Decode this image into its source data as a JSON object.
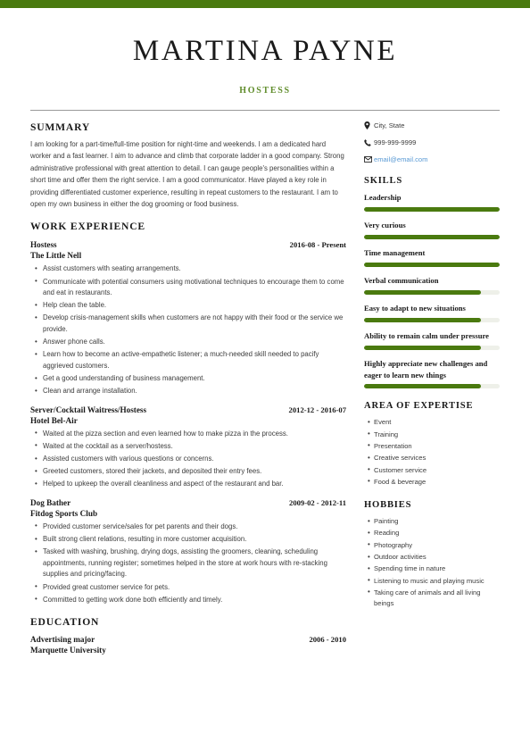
{
  "theme": {
    "accent_green": "#4a7a0f",
    "title_green": "#5f8c2a",
    "link_blue": "#5b9bd5",
    "track_gray": "#eef0e9"
  },
  "header": {
    "name": "MARTINA PAYNE",
    "job_title": "HOSTESS"
  },
  "summary": {
    "heading": "SUMMARY",
    "text": "I am looking for a part-time/full-time position for night-time and weekends. I am a dedicated hard worker and a fast learner. I aim to advance and climb that corporate ladder in a good company. Strong administrative professional with great attention to detail. I can gauge people's personalities within a short time and offer them the right service. I am a good communicator. Have played a key role in providing differentiated customer experience, resulting in repeat customers to the restaurant. I am to open my own business in either the dog grooming or food business."
  },
  "work_experience": {
    "heading": "WORK EXPERIENCE",
    "jobs": [
      {
        "position": "Hostess",
        "date": "2016-08 - Present",
        "company": "The Little Nell",
        "bullets": [
          "Assist customers with seating arrangements.",
          "Communicate with potential consumers using motivational techniques to encourage them to come and eat in restaurants.",
          "Help clean the table.",
          "Develop crisis-management skills when customers are not happy with their food or the service we provide.",
          "Answer phone calls.",
          "Learn how to become an active-empathetic listener; a much-needed skill needed to pacify aggrieved customers.",
          "Get a good understanding of business management.",
          "Clean and arrange installation."
        ]
      },
      {
        "position": "Server/Cocktail Waitress/Hostess",
        "date": "2012-12 - 2016-07",
        "company": "Hotel Bel-Air",
        "bullets": [
          "Waited at the pizza section and even learned how to make pizza in the process.",
          "Waited at the cocktail as a server/hostess.",
          "Assisted customers with various questions or concerns.",
          "Greeted customers, stored their jackets, and deposited their entry fees.",
          "Helped to upkeep the overall cleanliness and aspect of the restaurant and bar."
        ]
      },
      {
        "position": "Dog Bather",
        "date": "2009-02 - 2012-11",
        "company": "Fitdog Sports Club",
        "bullets": [
          "Provided customer service/sales for pet parents and their dogs.",
          "Built strong client relations, resulting in more customer acquisition.",
          "Tasked with washing, brushing, drying dogs, assisting the groomers, cleaning, scheduling appointments, running register; sometimes helped in the store at work hours with re-stacking supplies and pricing/facing.",
          "Provided great customer service for pets.",
          "Committed to getting work done both efficiently and timely."
        ]
      }
    ]
  },
  "education": {
    "heading": "EDUCATION",
    "entries": [
      {
        "degree": "Advertising major",
        "date": "2006 - 2010",
        "school": "Marquette University"
      }
    ]
  },
  "contact": {
    "items": [
      {
        "icon": "location-pin-icon",
        "value": "City, State"
      },
      {
        "icon": "phone-icon",
        "value": "999-999-9999"
      },
      {
        "icon": "envelope-icon",
        "value": "email@email.com"
      }
    ]
  },
  "skills": {
    "heading": "SKILLS",
    "items": [
      {
        "name": "Leadership",
        "level": 100
      },
      {
        "name": "Very curious",
        "level": 100
      },
      {
        "name": "Time management",
        "level": 100
      },
      {
        "name": "Verbal communication",
        "level": 86
      },
      {
        "name": "Easy to adapt to new situations",
        "level": 86
      },
      {
        "name": "Ability to remain calm under pressure",
        "level": 86
      },
      {
        "name": "Highly appreciate new challenges and eager to learn new things",
        "level": 86
      }
    ]
  },
  "area_of_expertise": {
    "heading": "AREA OF EXPERTISE",
    "items": [
      "Event",
      "Training",
      "Presentation",
      "Creative services",
      "Customer service",
      "Food & beverage"
    ]
  },
  "hobbies": {
    "heading": "HOBBIES",
    "items": [
      "Painting",
      "Reading",
      "Photography",
      "Outdoor activities",
      "Spending time in nature",
      "Listening to music and playing music",
      "Taking care of animals and all living beings"
    ]
  }
}
